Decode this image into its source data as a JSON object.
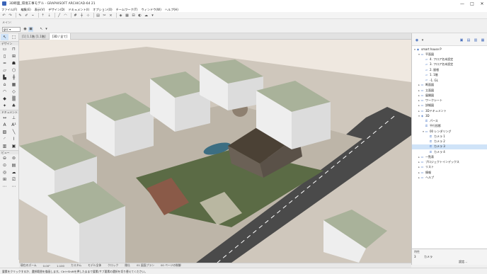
{
  "window": {
    "title": "3D断面_環境工事モデル - GRAPHISOFT ARCHICAD-64 21",
    "controls": [
      "—",
      "□",
      "✕"
    ]
  },
  "menu": [
    "ファイル(F)",
    "編集(E)",
    "表示(V)",
    "デザイン(D)",
    "ドキュメント(I)",
    "オプション(O)",
    "チームワーク(T)",
    "ウィンドウ(W)",
    "ヘルプ(H)"
  ],
  "infobox": {
    "label": "メイン:",
    "select_value": "gsc ▾"
  },
  "toolbox": {
    "design_label": "デザイン",
    "document_label": "ドキュメント",
    "view_label": "ビュー"
  },
  "tabs": [
    {
      "label": "[1] 1.1階 [1.1階]"
    },
    {
      "label": "[3D / 全て]"
    }
  ],
  "navigator": {
    "items": [
      {
        "label": "smart house P",
        "depth": 0,
        "icon": "project-icon",
        "exp": "▾"
      },
      {
        "label": "平面図",
        "depth": 1,
        "icon": "folder-icon",
        "exp": "▾"
      },
      {
        "label": "4. フロア名未設定",
        "depth": 2,
        "icon": "floor-icon",
        "exp": ""
      },
      {
        "label": "3. フロア名未設定",
        "depth": 2,
        "icon": "floor-icon",
        "exp": ""
      },
      {
        "label": "2. 屋根",
        "depth": 2,
        "icon": "floor-icon",
        "exp": ""
      },
      {
        "label": "1. 1階",
        "depth": 2,
        "icon": "floor-icon",
        "exp": ""
      },
      {
        "label": "-1. GL",
        "depth": 2,
        "icon": "floor-icon",
        "exp": ""
      },
      {
        "label": "断面図",
        "depth": 1,
        "icon": "folder-icon",
        "exp": "▸"
      },
      {
        "label": "立面図",
        "depth": 1,
        "icon": "folder-icon",
        "exp": "▸"
      },
      {
        "label": "展開図",
        "depth": 1,
        "icon": "folder-icon",
        "exp": "▸"
      },
      {
        "label": "ワークシート",
        "depth": 1,
        "icon": "folder-icon",
        "exp": "▸"
      },
      {
        "label": "詳細図",
        "depth": 1,
        "icon": "folder-icon",
        "exp": "▸"
      },
      {
        "label": "3Dドキュメント",
        "depth": 1,
        "icon": "folder-icon",
        "exp": "▸"
      },
      {
        "label": "3D",
        "depth": 1,
        "icon": "cube-icon",
        "exp": "▾"
      },
      {
        "label": "パース",
        "depth": 2,
        "icon": "camera-icon",
        "exp": ""
      },
      {
        "label": "平行投影",
        "depth": 2,
        "icon": "camera-icon",
        "exp": ""
      },
      {
        "label": "00 レンダリング",
        "depth": 2,
        "icon": "folder-icon",
        "exp": "▾"
      },
      {
        "label": "カメラ 1",
        "depth": 3,
        "icon": "camera-icon",
        "exp": ""
      },
      {
        "label": "カメラ 2",
        "depth": 3,
        "icon": "camera-icon",
        "exp": ""
      },
      {
        "label": "カメラ 3",
        "depth": 3,
        "icon": "camera-icon",
        "exp": "",
        "selected": true
      },
      {
        "label": "カメラ 4",
        "depth": 3,
        "icon": "camera-icon",
        "exp": ""
      },
      {
        "label": "一覧表",
        "depth": 1,
        "icon": "folder-icon",
        "exp": "▸"
      },
      {
        "label": "プロジェクトインデックス",
        "depth": 1,
        "icon": "folder-icon",
        "exp": "▸"
      },
      {
        "label": "リスト",
        "depth": 1,
        "icon": "folder-icon",
        "exp": "▸"
      },
      {
        "label": "情報",
        "depth": 1,
        "icon": "folder-icon",
        "exp": "▸"
      },
      {
        "label": "ヘルプ",
        "depth": 1,
        "icon": "folder-icon",
        "exp": "▸"
      }
    ]
  },
  "properties": {
    "header": "特性",
    "number": "3",
    "name": "カメラ",
    "settings_button": "設定..."
  },
  "bottombar": [
    "現在のズーム",
    "0.00°",
    "1:100",
    "カスタム",
    "モデル全体",
    "クロック",
    "間仕",
    "01 図面プラン",
    "00 ページの制御"
  ],
  "status": "要素をクリックするか、選択範囲を描画します。Ctrl+Shiftを押したままで要素/サブ要素の選択を切り替えてください。",
  "colors": {
    "selected_row": "#cfe3f8",
    "block_top": "#a9b29a",
    "block_side": "#eeeeee",
    "lawn": "#5b6b45",
    "road": "#4a4a4a"
  }
}
